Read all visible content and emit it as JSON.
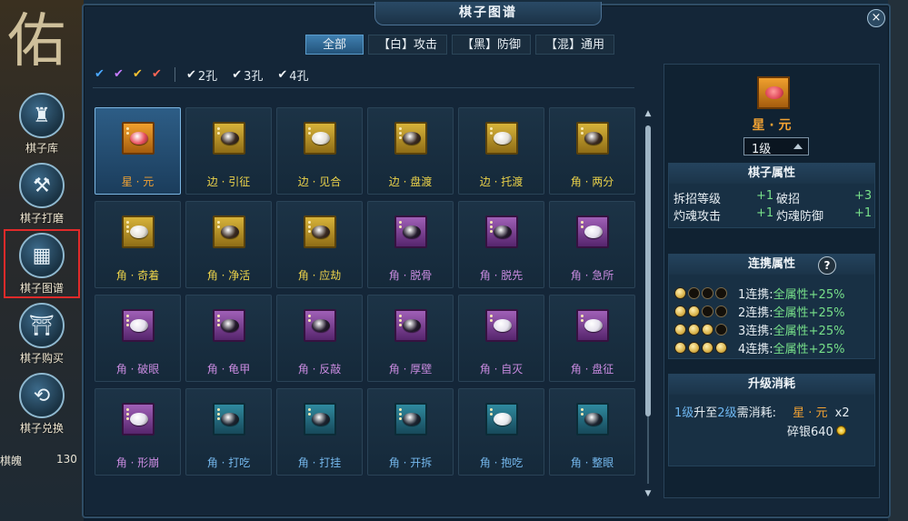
{
  "window": {
    "title": "棋子图谱",
    "close_label": "×"
  },
  "background": {
    "glyph": "佑"
  },
  "side_menu": [
    {
      "label": "棋子库",
      "icon": "chess-bag-icon",
      "glyph": "♜"
    },
    {
      "label": "棋子打磨",
      "icon": "hammer-icon",
      "glyph": "⚒"
    },
    {
      "label": "棋子图谱",
      "icon": "grid-board-icon",
      "glyph": "▦",
      "active": true
    },
    {
      "label": "棋子购买",
      "icon": "pavilion-shop-icon",
      "glyph": "⛩"
    },
    {
      "label": "棋子兑换",
      "icon": "exchange-icon",
      "glyph": "⟲"
    }
  ],
  "soul": {
    "label": "棋魄",
    "value": "130"
  },
  "tabs": [
    {
      "label": "全部",
      "active": true
    },
    {
      "label": "【白】攻击",
      "active": false
    },
    {
      "label": "【黑】防御",
      "active": false
    },
    {
      "label": "【混】通用",
      "active": false
    }
  ],
  "filters": {
    "checks": [
      {
        "icon": "check-blue-icon",
        "color": "#4aa8ff"
      },
      {
        "icon": "check-purple-icon",
        "color": "#c77cff"
      },
      {
        "icon": "check-gold-icon",
        "color": "#f2c031"
      },
      {
        "icon": "check-red-icon",
        "color": "#ff6655"
      }
    ],
    "holes": [
      "2孔",
      "3孔",
      "4孔"
    ],
    "hole_check_glyph": "✔"
  },
  "pieces": [
    {
      "name": "星 · 元",
      "frame": "orange",
      "stone": "#e8505e",
      "dots": 2,
      "name_color": "c-orange",
      "selected": true
    },
    {
      "name": "边 · 引征",
      "frame": "gold",
      "stone": "#3a2a20",
      "dots": 2,
      "name_color": "c-yellow"
    },
    {
      "name": "边 · 见合",
      "frame": "gold",
      "stone": "#e4e0d8",
      "dots": 2,
      "name_color": "c-yellow"
    },
    {
      "name": "边 · 盘渡",
      "frame": "gold",
      "stone": "#3a2a20",
      "dots": 3,
      "name_color": "c-yellow"
    },
    {
      "name": "边 · 托渡",
      "frame": "gold",
      "stone": "#e4e0d8",
      "dots": 2,
      "name_color": "c-yellow"
    },
    {
      "name": "角 · 两分",
      "frame": "gold",
      "stone": "#3a2a20",
      "dots": 2,
      "name_color": "c-yellow"
    },
    {
      "name": "角 · 奇着",
      "frame": "gold",
      "stone": "#e4e0d8",
      "dots": 3,
      "name_color": "c-yellow"
    },
    {
      "name": "角 · 净活",
      "frame": "gold",
      "stone": "#3a2a20",
      "dots": 2,
      "name_color": "c-yellow"
    },
    {
      "name": "角 · 应劫",
      "frame": "gold",
      "stone": "#3a2a20",
      "dots": 3,
      "name_color": "c-yellow"
    },
    {
      "name": "角 · 脱骨",
      "frame": "purple",
      "stone": "#231a2c",
      "dots": 2,
      "name_color": "c-purple"
    },
    {
      "name": "角 · 脱先",
      "frame": "purple",
      "stone": "#231a2c",
      "dots": 3,
      "name_color": "c-purple"
    },
    {
      "name": "角 · 急所",
      "frame": "purple",
      "stone": "#e4e0ec",
      "dots": 2,
      "name_color": "c-purple"
    },
    {
      "name": "角 · 破眼",
      "frame": "purple",
      "stone": "#e4e0ec",
      "dots": 3,
      "name_color": "c-purple"
    },
    {
      "name": "角 · 龟甲",
      "frame": "purple",
      "stone": "#231a2c",
      "dots": 3,
      "name_color": "c-purple"
    },
    {
      "name": "角 · 反敲",
      "frame": "purple",
      "stone": "#231a2c",
      "dots": 2,
      "name_color": "c-purple"
    },
    {
      "name": "角 · 厚壁",
      "frame": "purple",
      "stone": "#231a2c",
      "dots": 3,
      "name_color": "c-purple"
    },
    {
      "name": "角 · 自灭",
      "frame": "purple",
      "stone": "#e4e0ec",
      "dots": 2,
      "name_color": "c-purple"
    },
    {
      "name": "角 · 盘征",
      "frame": "purple",
      "stone": "#e4e0ec",
      "dots": 2,
      "name_color": "c-purple"
    },
    {
      "name": "角 · 形崩",
      "frame": "purple",
      "stone": "#e4e0ec",
      "dots": 3,
      "name_color": "c-purple"
    },
    {
      "name": "角 · 打吃",
      "frame": "teal",
      "stone": "#1c2430",
      "dots": 3,
      "name_color": "c-blue"
    },
    {
      "name": "角 · 打挂",
      "frame": "teal",
      "stone": "#1c2430",
      "dots": 2,
      "name_color": "c-blue"
    },
    {
      "name": "角 · 开拆",
      "frame": "teal",
      "stone": "#1c2430",
      "dots": 3,
      "name_color": "c-blue"
    },
    {
      "name": "角 · 抱吃",
      "frame": "teal",
      "stone": "#e4e8ec",
      "dots": 2,
      "name_color": "c-blue"
    },
    {
      "name": "角 · 整眼",
      "frame": "teal",
      "stone": "#1c2430",
      "dots": 2,
      "name_color": "c-blue"
    }
  ],
  "detail": {
    "name": "星 · 元",
    "level": "1级",
    "attr_title": "棋子属性",
    "attrs": [
      {
        "label": "拆招等级",
        "value": "+1"
      },
      {
        "label": "破招",
        "value": "+3"
      },
      {
        "label": "灼魂攻击",
        "value": "+1"
      },
      {
        "label": "灼魂防御",
        "value": "+1"
      }
    ],
    "link_title": "连携属性",
    "help_label": "?",
    "links": [
      {
        "on": 1,
        "label": "1连携:",
        "effect": "全属性+25%"
      },
      {
        "on": 2,
        "label": "2连携:",
        "effect": "全属性+25%"
      },
      {
        "on": 3,
        "label": "3连携:",
        "effect": "全属性+25%"
      },
      {
        "on": 4,
        "label": "4连携:",
        "effect": "全属性+25%"
      }
    ],
    "upgrade_title": "升级消耗",
    "upgrade": {
      "from": "1级",
      "mid": "升至",
      "to": "2级",
      "suffix": "需消耗:",
      "item": "星 · 元",
      "qty": "x2",
      "silver": "碎银640"
    }
  }
}
